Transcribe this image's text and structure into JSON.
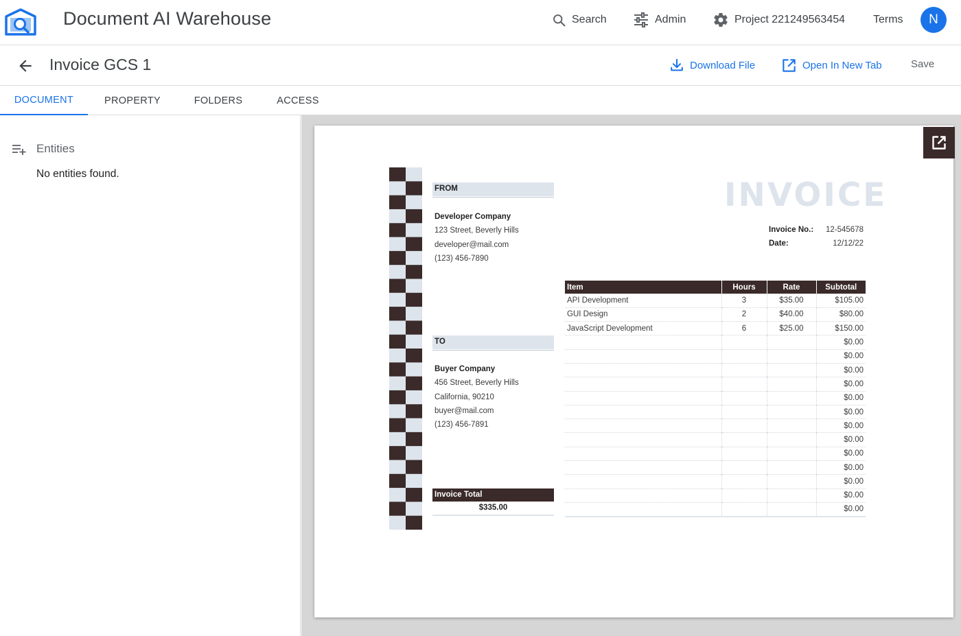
{
  "app": {
    "title": "Document AI Warehouse",
    "avatar_initial": "N"
  },
  "nav": {
    "search_label": "Search",
    "admin_label": "Admin",
    "project_label": "Project 221249563454",
    "terms_label": "Terms"
  },
  "document": {
    "title": "Invoice GCS 1",
    "download_label": "Download File",
    "open_new_tab_label": "Open In New Tab",
    "save_label": "Save"
  },
  "tabs": [
    {
      "label": "DOCUMENT",
      "active": true
    },
    {
      "label": "PROPERTY",
      "active": false
    },
    {
      "label": "FOLDERS",
      "active": false
    },
    {
      "label": "ACCESS",
      "active": false
    }
  ],
  "entities": {
    "title": "Entities",
    "empty_text": "No entities found."
  },
  "invoice": {
    "heading": "INVOICE",
    "from": {
      "label": "FROM",
      "name": "Developer Company",
      "address": "123 Street, Beverly Hills",
      "email": "developer@mail.com",
      "phone": "(123) 456-7890"
    },
    "to": {
      "label": "TO",
      "name": "Buyer Company",
      "address": "456 Street, Beverly Hills",
      "city": "California, 90210",
      "email": "buyer@mail.com",
      "phone": "(123) 456-7891"
    },
    "invoice_no_label": "Invoice No.:",
    "invoice_no": "12-545678",
    "date_label": "Date:",
    "date": "12/12/22",
    "columns": [
      "Item",
      "Hours",
      "Rate",
      "Subtotal"
    ],
    "rows": [
      [
        "API Development",
        "3",
        "$35.00",
        "$105.00"
      ],
      [
        "GUI Design",
        "2",
        "$40.00",
        "$80.00"
      ],
      [
        "JavaScript Development",
        "6",
        "$25.00",
        "$150.00"
      ],
      [
        "",
        "",
        "",
        "$0.00"
      ],
      [
        "",
        "",
        "",
        "$0.00"
      ],
      [
        "",
        "",
        "",
        "$0.00"
      ],
      [
        "",
        "",
        "",
        "$0.00"
      ],
      [
        "",
        "",
        "",
        "$0.00"
      ],
      [
        "",
        "",
        "",
        "$0.00"
      ],
      [
        "",
        "",
        "",
        "$0.00"
      ],
      [
        "",
        "",
        "",
        "$0.00"
      ],
      [
        "",
        "",
        "",
        "$0.00"
      ],
      [
        "",
        "",
        "",
        "$0.00"
      ],
      [
        "",
        "",
        "",
        "$0.00"
      ],
      [
        "",
        "",
        "",
        "$0.00"
      ],
      [
        "",
        "",
        "",
        "$0.00"
      ]
    ],
    "total_label": "Invoice Total",
    "total_value": "$335.00"
  },
  "colors": {
    "accent": "#1a73e8",
    "invoice_dark": "#3a2a29",
    "invoice_light": "#dde4ec"
  },
  "icons": {
    "logo": "warehouse-search-logo",
    "search": "search-icon",
    "admin": "tune-icon",
    "project": "gear-icon",
    "back": "arrow-left-icon",
    "download": "download-icon",
    "open_new_tab": "open-in-new-icon",
    "entities": "playlist-add-icon"
  }
}
